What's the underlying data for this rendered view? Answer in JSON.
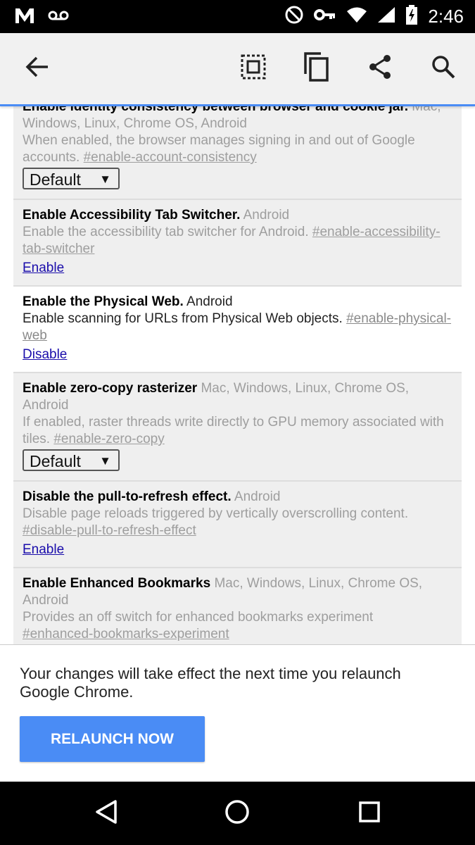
{
  "status_bar": {
    "time": "2:46",
    "icons": [
      "gmail-icon",
      "voicemail-icon",
      "do-not-disturb-icon",
      "vpn-key-icon",
      "wifi-icon",
      "cell-signal-icon",
      "battery-charging-icon"
    ]
  },
  "toolbar": {
    "icons": [
      "back-arrow-icon",
      "select-all-icon",
      "copy-icon",
      "share-icon",
      "search-icon"
    ]
  },
  "experiments": [
    {
      "title": "Enable identity consistency between browser and cookie jar.",
      "platforms": "Mac, Windows, Linux, Chrome OS, Android",
      "description": "When enabled, the browser manages signing in and out of Google accounts.",
      "hash": "#enable-account-consistency",
      "control": "select",
      "value": "Default"
    },
    {
      "title": "Enable Accessibility Tab Switcher.",
      "platforms": "Android",
      "description": "Enable the accessibility tab switcher for Android.",
      "hash": "#enable-accessibility-tab-switcher",
      "control": "link",
      "value": "Enable"
    },
    {
      "title": "Enable the Physical Web.",
      "platforms": "Android",
      "description": "Enable scanning for URLs from Physical Web objects.",
      "hash": "#enable-physical-web",
      "control": "link",
      "value": "Disable"
    },
    {
      "title": "Enable zero-copy rasterizer",
      "platforms": "Mac, Windows, Linux, Chrome OS, Android",
      "description": "If enabled, raster threads write directly to GPU memory associated with tiles.",
      "hash": "#enable-zero-copy",
      "control": "select",
      "value": "Default"
    },
    {
      "title": "Disable the pull-to-refresh effect.",
      "platforms": "Android",
      "description": "Disable page reloads triggered by vertically overscrolling content.",
      "hash": "#disable-pull-to-refresh-effect",
      "control": "link",
      "value": "Enable"
    },
    {
      "title": "Enable Enhanced Bookmarks",
      "platforms": "Mac, Windows, Linux, Chrome OS, Android",
      "description": "Provides an off switch for enhanced bookmarks experiment",
      "hash": "#enhanced-bookmarks-experiment",
      "control": "none",
      "value": ""
    }
  ],
  "banner": {
    "message": "Your changes will take effect the next time you relaunch Google Chrome.",
    "button_label": "RELAUNCH NOW"
  },
  "nav_bar": {
    "icons": [
      "back-triangle-icon",
      "home-circle-icon",
      "recents-square-icon"
    ]
  },
  "colors": {
    "accent": "#4a8cf5",
    "link": "#1a0dab"
  }
}
